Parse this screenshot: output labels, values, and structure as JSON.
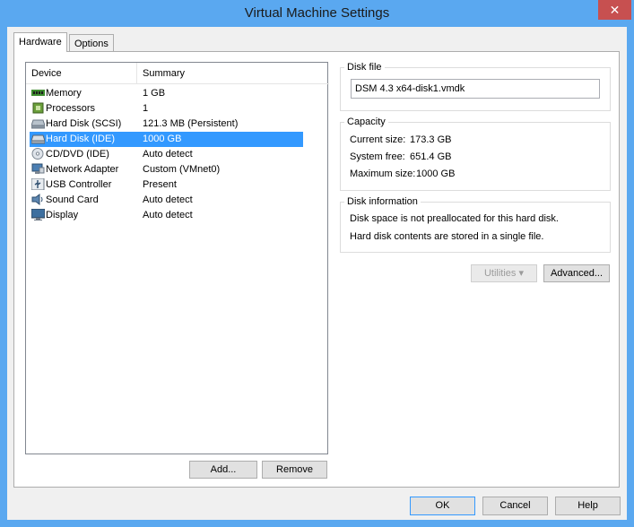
{
  "window": {
    "title": "Virtual Machine Settings",
    "close_glyph": "✕"
  },
  "tabs": [
    {
      "label": "Hardware"
    },
    {
      "label": "Options"
    }
  ],
  "device_list": {
    "columns": {
      "device": "Device",
      "summary": "Summary"
    },
    "rows": [
      {
        "device": "Memory",
        "summary": "1 GB",
        "icon": "memory-icon"
      },
      {
        "device": "Processors",
        "summary": "1",
        "icon": "processor-icon"
      },
      {
        "device": "Hard Disk (SCSI)",
        "summary": "121.3 MB (Persistent)",
        "icon": "hard-disk-icon"
      },
      {
        "device": "Hard Disk (IDE)",
        "summary": "1000 GB",
        "icon": "hard-disk-icon"
      },
      {
        "device": "CD/DVD (IDE)",
        "summary": "Auto detect",
        "icon": "cd-dvd-icon"
      },
      {
        "device": "Network Adapter",
        "summary": "Custom (VMnet0)",
        "icon": "network-adapter-icon"
      },
      {
        "device": "USB Controller",
        "summary": "Present",
        "icon": "usb-icon"
      },
      {
        "device": "Sound Card",
        "summary": "Auto detect",
        "icon": "speaker-icon"
      },
      {
        "device": "Display",
        "summary": "Auto detect",
        "icon": "monitor-icon"
      }
    ],
    "selected_index": 3
  },
  "list_buttons": {
    "add": "Add...",
    "remove": "Remove"
  },
  "disk_file": {
    "label": "Disk file",
    "value": "DSM 4.3 x64-disk1.vmdk"
  },
  "capacity": {
    "label": "Capacity",
    "current_label": "Current size:",
    "current_value": "173.3 GB",
    "free_label": "System free:",
    "free_value": "651.4 GB",
    "max_label": "Maximum size:",
    "max_value": "1000 GB"
  },
  "disk_info": {
    "label": "Disk information",
    "line1": "Disk space is not preallocated for this hard disk.",
    "line2": "Hard disk contents are stored in a single file."
  },
  "disk_buttons": {
    "utilities": "Utilities",
    "advanced": "Advanced..."
  },
  "dialog_buttons": {
    "ok": "OK",
    "cancel": "Cancel",
    "help": "Help"
  },
  "colors": {
    "accent": "#3399ff",
    "close": "#c75050",
    "frame": "#5aa8f0"
  }
}
